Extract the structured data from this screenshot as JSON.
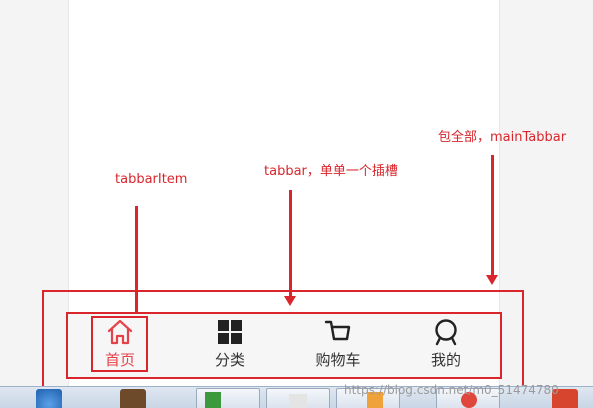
{
  "annotations": {
    "main_tabbar": "包全部，mainTabbar",
    "tabbar": "tabbar，单单一个插槽",
    "tabbar_item": "tabbarItem"
  },
  "tabbar": {
    "items": [
      {
        "label": "首页",
        "icon": "home-icon",
        "active": true
      },
      {
        "label": "分类",
        "icon": "grid-icon",
        "active": false
      },
      {
        "label": "购物车",
        "icon": "cart-icon",
        "active": false
      },
      {
        "label": "我的",
        "icon": "profile-icon",
        "active": false
      }
    ]
  },
  "watermark": "https://blog.csdn.net/m0_51474780",
  "colors": {
    "annotation": "#d9252b",
    "active_tab": "#e5434a",
    "inactive_icon": "#222222"
  }
}
